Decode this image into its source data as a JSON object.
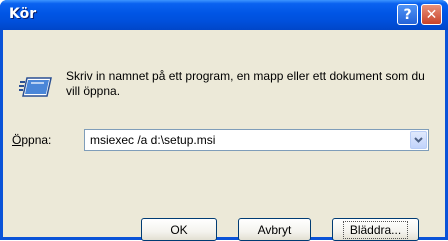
{
  "window": {
    "title": "Kör",
    "help_button": "?",
    "close_button": "✕"
  },
  "description": "Skriv in namnet på ett program, en mapp eller ett dokument som du vill öppna.",
  "open_field": {
    "label_access_key": "Ö",
    "label_rest": "ppna:",
    "value": "msiexec /a d:\\setup.msi"
  },
  "buttons": {
    "ok": "OK",
    "cancel": "Avbryt",
    "browse": "Bläddra..."
  },
  "colors": {
    "titlebar": "#0055e5",
    "dialog_bg": "#ece9d8",
    "close_button": "#c8432a"
  }
}
